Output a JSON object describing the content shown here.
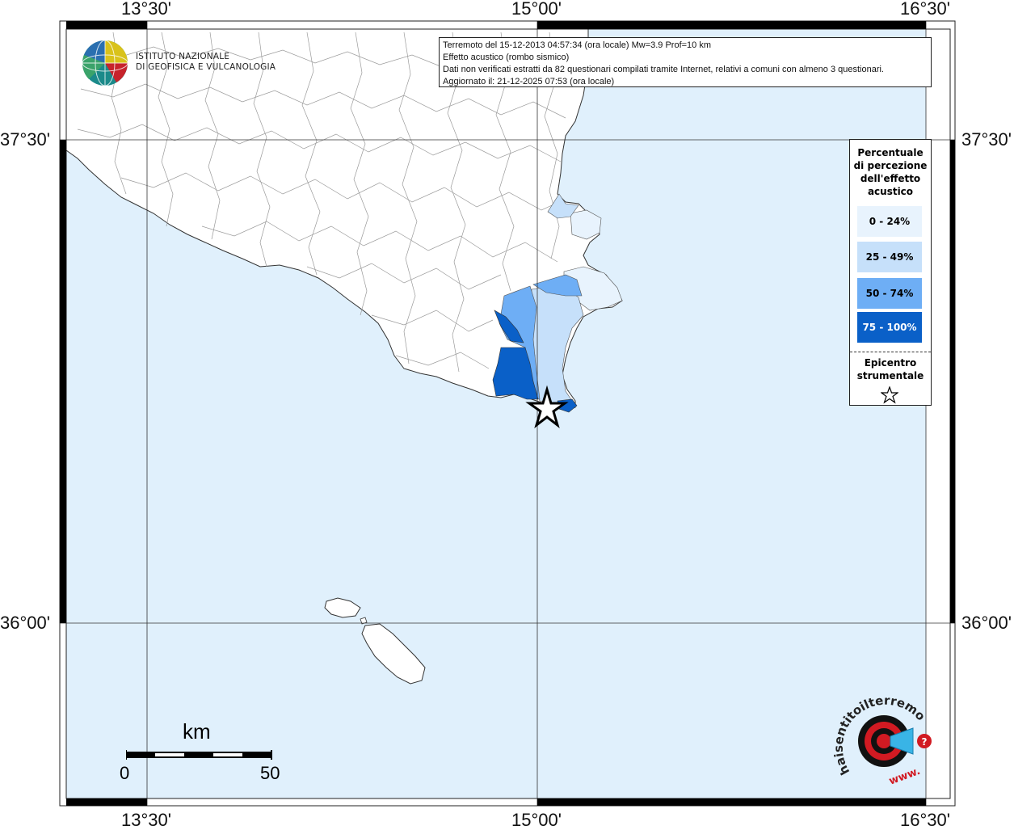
{
  "info": {
    "line1": "Terremoto del 15-12-2013 04:57:34 (ora locale) Mw=3.9 Prof=10 km",
    "line2": "Effetto acustico (rombo sismico)",
    "line3": "Dati non verificati estratti da 82 questionari compilati tramite Internet, relativi a comuni con almeno 3 questionari.",
    "line4": "Aggiornato il: 21-12-2025 07:53 (ora locale)"
  },
  "coords": {
    "lon1": "13°30'",
    "lon2": "15°00'",
    "lon3": "16°30'",
    "lat1": "37°30'",
    "lat2": "36°00'"
  },
  "logo": {
    "line1": "ISTITUTO NAZIONALE",
    "line2": "DI GEOFISICA E VULCANOLOGIA"
  },
  "legend": {
    "title_lines": [
      "Percentuale",
      "di percezione",
      "dell'effetto",
      "acustico"
    ],
    "classes": [
      {
        "label": "0 - 24%",
        "color": "#e8f3fd",
        "text_color": "#000000"
      },
      {
        "label": "25 - 49%",
        "color": "#c6e0fa",
        "text_color": "#000000"
      },
      {
        "label": "50 - 74%",
        "color": "#6eaef5",
        "text_color": "#000000"
      },
      {
        "label": "75 - 100%",
        "color": "#0a60c8",
        "text_color": "#ffffff"
      }
    ],
    "epicenter_lines": [
      "Epicentro",
      "strumentale"
    ]
  },
  "scale": {
    "unit": "km",
    "start": "0",
    "end": "50"
  },
  "hai_logo": {
    "arc_text": "haisentitoilterremoto.it",
    "www_text": "www.",
    "question": "?"
  },
  "colors": {
    "sea": "#e0f0fc",
    "land": "#ffffff",
    "star_outline": "#000000"
  },
  "icons": {
    "epicenter": "star-icon",
    "ingv": "ingv-globe-icon",
    "hai": "megaphone-target-icon"
  }
}
